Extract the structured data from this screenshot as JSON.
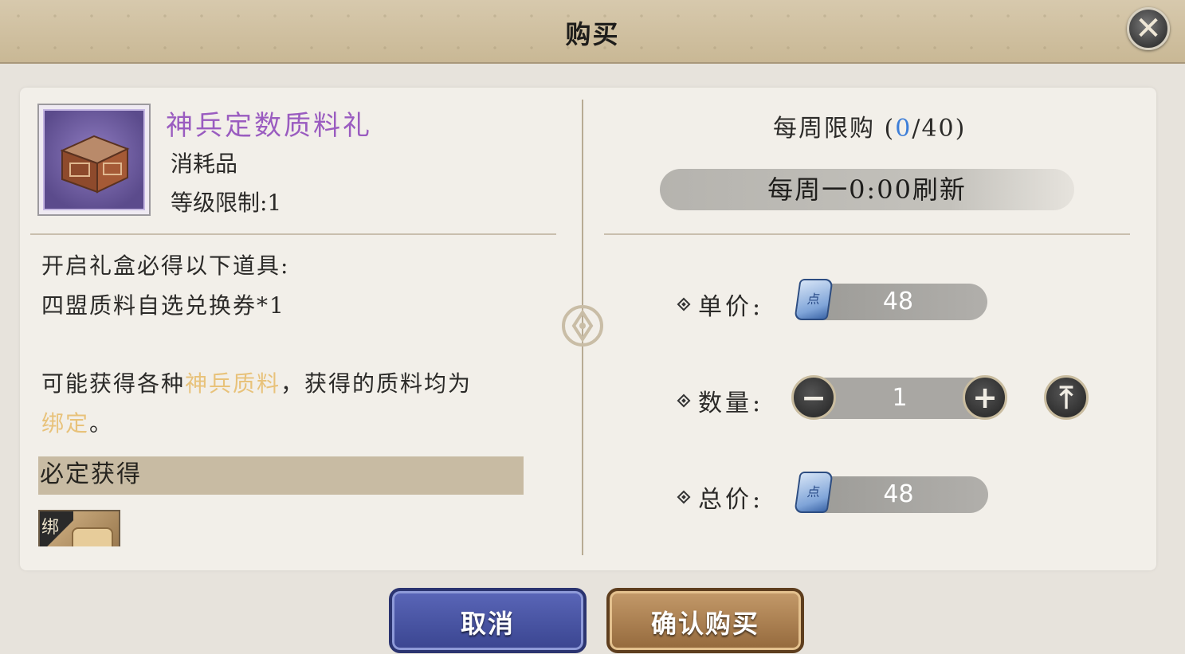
{
  "header": {
    "title": "购买",
    "close_icon": "close-icon"
  },
  "item": {
    "name": "神兵定数质料礼",
    "type": "消耗品",
    "level_limit": "等级限制:1",
    "icon": "treasure-chest-icon"
  },
  "description": {
    "line1": "开启礼盒必得以下道具:",
    "line2": "四盟质料自选兑换券*1",
    "line3_prefix": "可能获得各种",
    "line3_highlight": "神兵质料",
    "line3_suffix": "，获得的质料均为",
    "line4_highlight": "绑定",
    "line4_suffix": "。"
  },
  "section": {
    "title": "必定获得"
  },
  "reward": {
    "bind_tag": "绑",
    "icon": "scroll-icon"
  },
  "purchase": {
    "weekly_label": "每周限购 (",
    "weekly_bought": "0",
    "weekly_sep": "/",
    "weekly_max": "40",
    "weekly_close": ")",
    "refresh_text": "每周一0:00刷新",
    "unit_price_label": "单价:",
    "unit_price": "48",
    "quantity_label": "数量:",
    "quantity": "1",
    "total_label": "总价:",
    "total_price": "48",
    "currency_icon": "ticket-icon",
    "currency_glyph": "点",
    "minus_glyph": "−",
    "plus_glyph": "+",
    "max_glyph": "⤒"
  },
  "buttons": {
    "cancel": "取消",
    "confirm": "确认购买"
  },
  "colors": {
    "accent_purple": "#9a5cc0",
    "highlight_gold": "#e8c27a",
    "blue": "#3d7ed8"
  }
}
